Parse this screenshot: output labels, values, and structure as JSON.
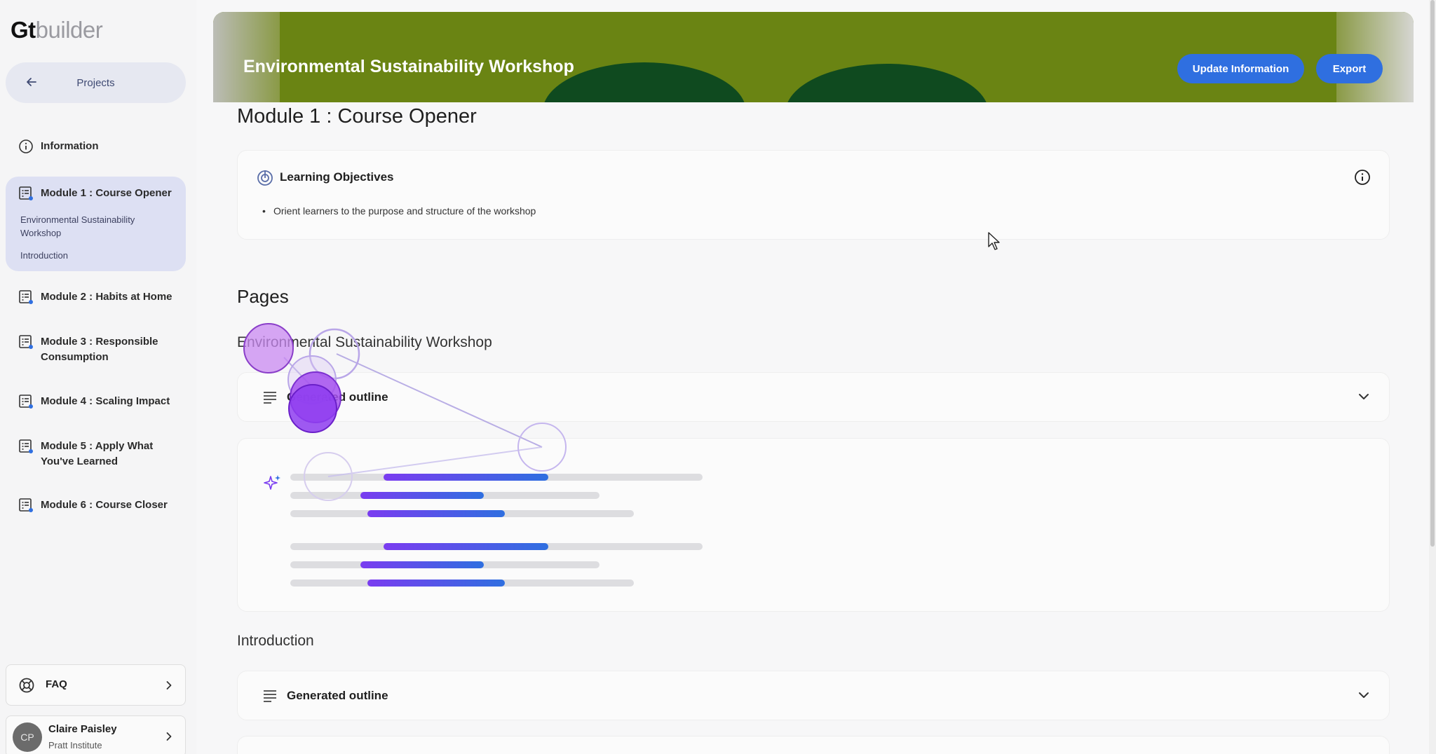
{
  "logo": {
    "gt": "Gt",
    "builder": "builder"
  },
  "sidebar": {
    "projects_label": "Projects",
    "information_label": "Information",
    "modules": [
      {
        "label": "Module 1 : Course Opener",
        "sub": [
          "Environmental Sustainability Workshop",
          "Introduction"
        ]
      },
      {
        "label": "Module 2 : Habits at Home"
      },
      {
        "label": "Module 3 : Responsible Consumption"
      },
      {
        "label": "Module 4 : Scaling Impact"
      },
      {
        "label": "Module 5 : Apply What You've Learned"
      },
      {
        "label": "Module 6 : Course Closer"
      }
    ],
    "faq_label": "FAQ",
    "user": {
      "initials": "CP",
      "name": "Claire Paisley",
      "org": "Pratt Institute"
    }
  },
  "banner": {
    "title": "Environmental Sustainability Workshop",
    "update_label": "Update Information",
    "export_label": "Export"
  },
  "main": {
    "module_title": "Module 1 : Course Opener",
    "learning_objectives": {
      "title": "Learning Objectives",
      "items": [
        "Orient learners to the purpose and structure of the workshop"
      ]
    },
    "pages_heading": "Pages",
    "sections": [
      {
        "heading": "Environmental Sustainability Workshop",
        "outline_label": "Generated outline"
      },
      {
        "heading": "Introduction",
        "outline_label": "Generated outline"
      }
    ]
  },
  "colors": {
    "accent": "#2f6fe0",
    "active_nav": "#dde0f3",
    "banner_green": "#6a8413",
    "sparkle": "#7a3cf0"
  }
}
